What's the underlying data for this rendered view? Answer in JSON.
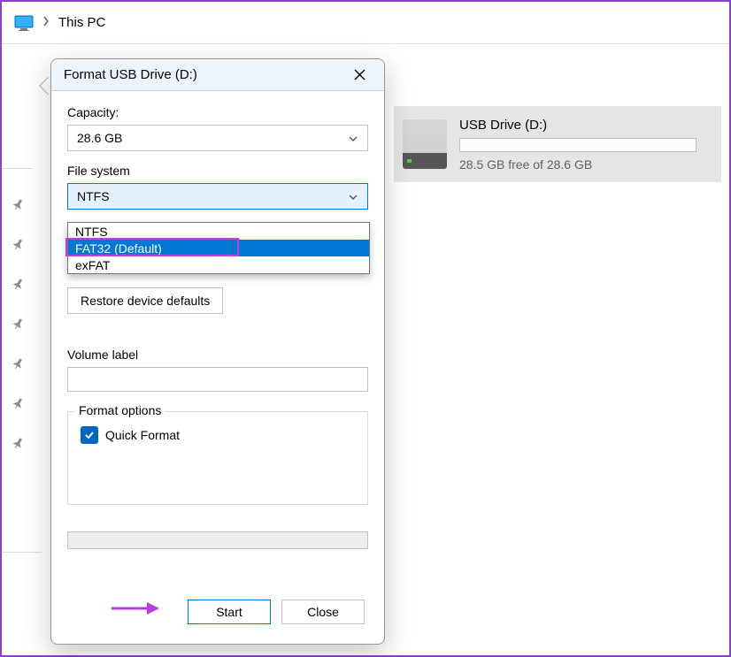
{
  "breadcrumb": {
    "location": "This PC"
  },
  "drive": {
    "name": "USB Drive (D:)",
    "free_text": "28.5 GB free of 28.6 GB"
  },
  "dialog": {
    "title": "Format USB Drive (D:)",
    "capacity_label": "Capacity:",
    "capacity_value": "28.6 GB",
    "filesystem_label": "File system",
    "filesystem_selected": "NTFS",
    "filesystem_options": [
      "NTFS",
      "FAT32 (Default)",
      "exFAT"
    ],
    "restore_label": "Restore device defaults",
    "volume_label": "Volume label",
    "volume_value": "",
    "format_options_title": "Format options",
    "quick_format_label": "Quick Format",
    "quick_format_checked": true,
    "start_label": "Start",
    "close_label": "Close"
  }
}
